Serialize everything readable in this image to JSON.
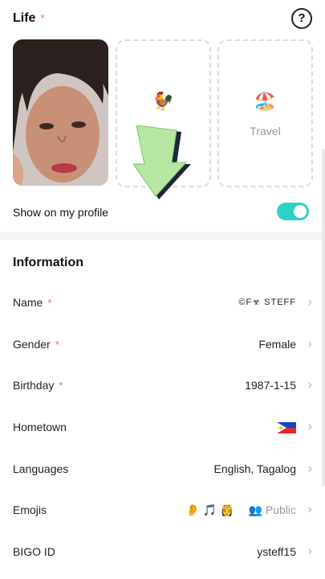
{
  "life": {
    "title": "Life",
    "required_mark": "*",
    "help_icon": "?",
    "slots": [
      {
        "emoji": "🐓",
        "label": ""
      },
      {
        "emoji": "🏖️",
        "label": "Travel"
      }
    ],
    "show_on_profile_label": "Show on my profile",
    "show_on_profile_enabled": true
  },
  "information": {
    "title": "Information",
    "rows": {
      "name": {
        "label": "Name",
        "required": "*",
        "value": "©F☣ STEFF"
      },
      "gender": {
        "label": "Gender",
        "required": "*",
        "value": "Female"
      },
      "birthday": {
        "label": "Birthday",
        "required": "*",
        "value": "1987-1-15"
      },
      "hometown": {
        "label": "Hometown",
        "flag_icon": "philippines-flag-icon"
      },
      "languages": {
        "label": "Languages",
        "value": "English, Tagalog"
      },
      "emojis": {
        "label": "Emojis",
        "emoji_list": "👂 🎵 👸",
        "privacy": "Public",
        "privacy_icon": "users-icon"
      },
      "bigo_id": {
        "label": "BIGO ID",
        "value": "ysteff15"
      }
    }
  },
  "colors": {
    "accent": "#2fd1c5",
    "required": "#f06a8a"
  }
}
